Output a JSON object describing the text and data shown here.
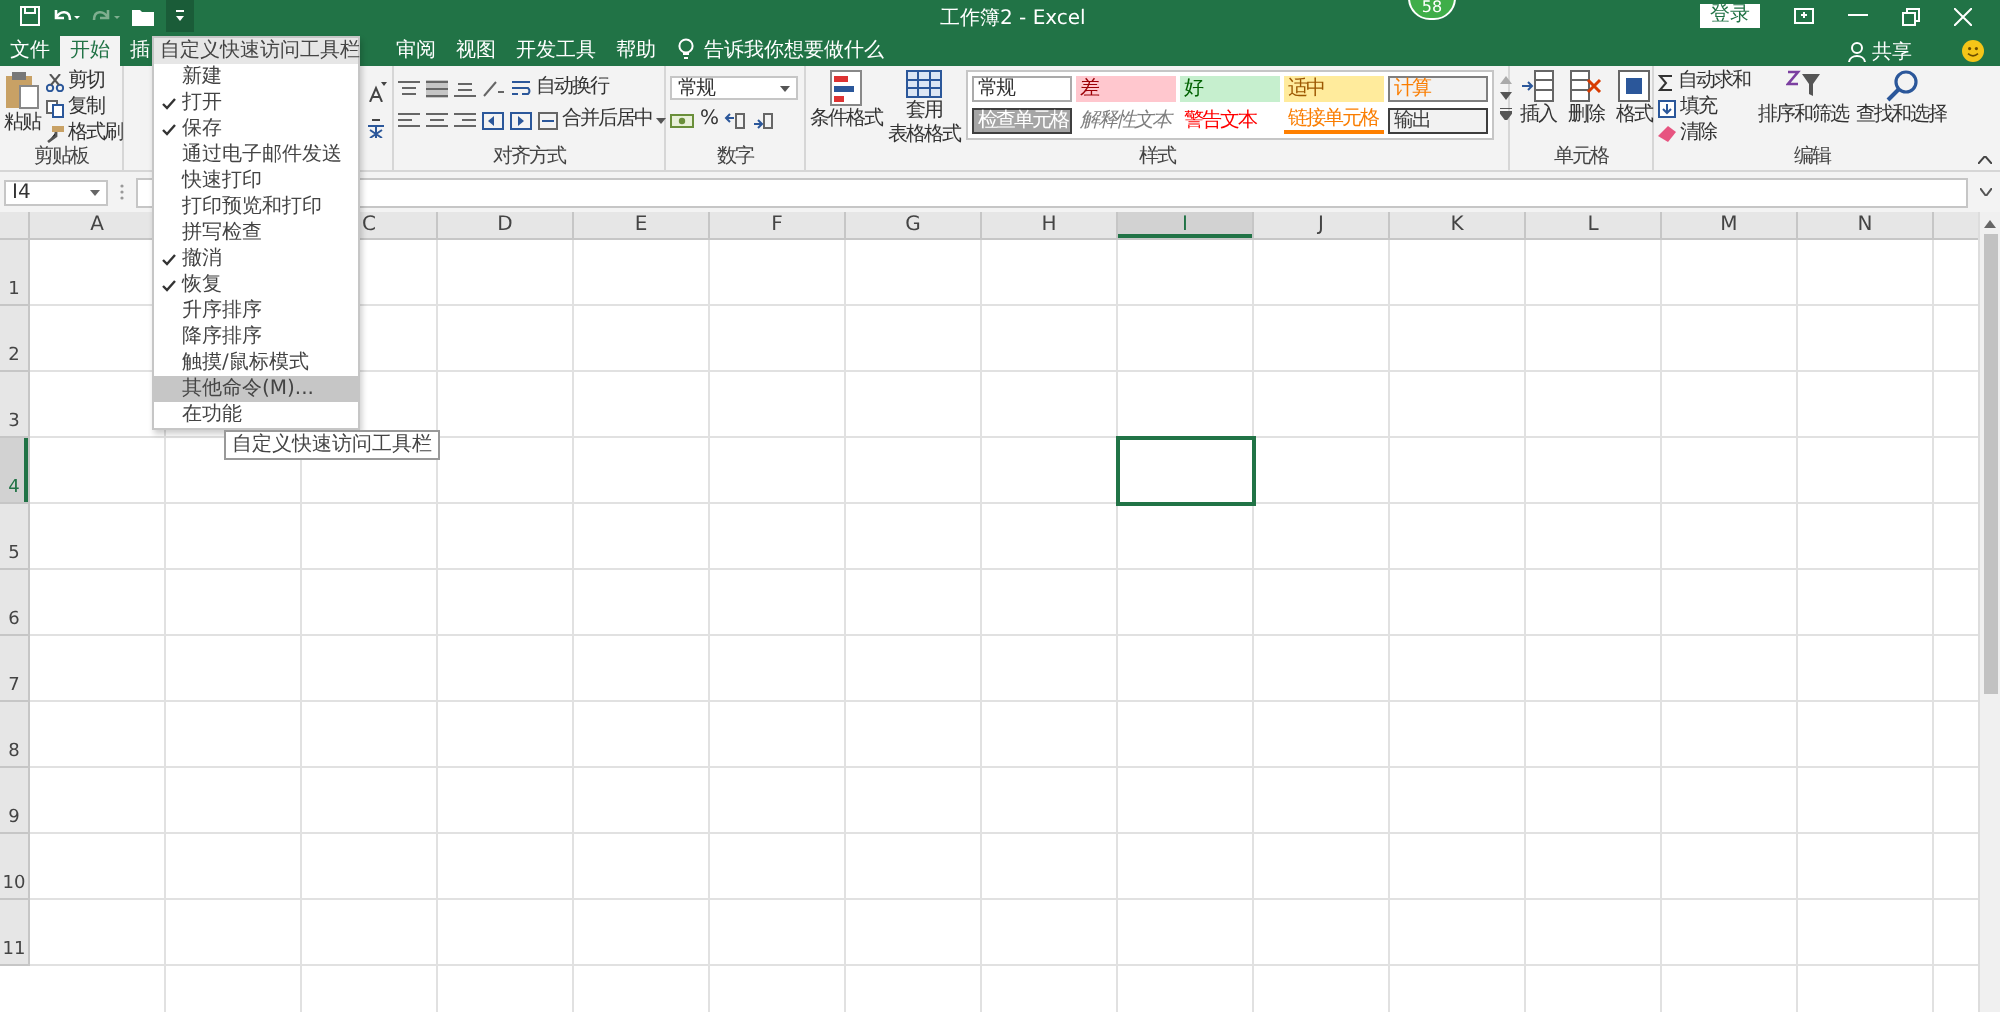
{
  "window": {
    "title": "工作簿2 - Excel",
    "sign_in": "登录",
    "badge": "58"
  },
  "tabs": [
    {
      "label": "文件",
      "selected": false
    },
    {
      "label": "开始",
      "selected": true
    },
    {
      "label": "插",
      "selected": false
    },
    {
      "label": "审阅",
      "selected": false
    },
    {
      "label": "视图",
      "selected": false
    },
    {
      "label": "开发工具",
      "selected": false
    },
    {
      "label": "帮助",
      "selected": false
    }
  ],
  "tell_me": "告诉我你想要做什么",
  "share": "共享",
  "ribbon": {
    "clipboard": {
      "paste": "粘贴",
      "cut": "剪切",
      "copy": "复制",
      "format_painter": "格式刷",
      "label": "剪贴板"
    },
    "alignment": {
      "wrap_text": "自动换行",
      "merge_center": "合并后居中",
      "label": "对齐方式"
    },
    "number": {
      "format": "常规",
      "percent": "%",
      "label": "数字"
    },
    "styles": {
      "conditional_formatting": "条件格式",
      "format_as_table": [
        "套用",
        "表格格式"
      ],
      "label": "样式",
      "gallery": [
        {
          "label": "常规",
          "kind": "normal"
        },
        {
          "label": "差",
          "kind": "bad"
        },
        {
          "label": "好",
          "kind": "good"
        },
        {
          "label": "适中",
          "kind": "neutral"
        },
        {
          "label": "计算",
          "kind": "calculation"
        },
        {
          "label": "检查单元格",
          "kind": "check"
        },
        {
          "label": "解释性文本",
          "kind": "explanatory"
        },
        {
          "label": "警告文本",
          "kind": "warning"
        },
        {
          "label": "链接单元格",
          "kind": "linked"
        },
        {
          "label": "输出",
          "kind": "output"
        }
      ]
    },
    "cells": {
      "insert": "插入",
      "delete": "删除",
      "format": "格式",
      "label": "单元格"
    },
    "editing": {
      "autosum": "自动求和",
      "fill": "填充",
      "clear": "清除",
      "sort_filter": "排序和筛选",
      "find_select": "查找和选择",
      "label": "编辑"
    }
  },
  "name_box": "I4",
  "columns": [
    {
      "label": "A",
      "selected": false
    },
    {
      "label": "C",
      "selected": false
    },
    {
      "label": "D",
      "selected": false
    },
    {
      "label": "E",
      "selected": false
    },
    {
      "label": "F",
      "selected": false
    },
    {
      "label": "G",
      "selected": false
    },
    {
      "label": "H",
      "selected": false
    },
    {
      "label": "I",
      "selected": true
    },
    {
      "label": "J",
      "selected": false
    },
    {
      "label": "K",
      "selected": false
    },
    {
      "label": "L",
      "selected": false
    },
    {
      "label": "M",
      "selected": false
    },
    {
      "label": "N",
      "selected": false
    }
  ],
  "rows": [
    {
      "label": "1",
      "selected": false
    },
    {
      "label": "2",
      "selected": false
    },
    {
      "label": "3",
      "selected": false
    },
    {
      "label": "4",
      "selected": true
    },
    {
      "label": "5",
      "selected": false
    },
    {
      "label": "6",
      "selected": false
    },
    {
      "label": "7",
      "selected": false
    },
    {
      "label": "8",
      "selected": false
    },
    {
      "label": "9",
      "selected": false
    },
    {
      "label": "10",
      "selected": false
    },
    {
      "label": "11",
      "selected": false
    }
  ],
  "qat_menu": {
    "title": "自定义快速访问工具栏",
    "items": [
      {
        "label": "新建",
        "checked": false,
        "selected": false
      },
      {
        "label": "打开",
        "checked": true,
        "selected": false
      },
      {
        "label": "保存",
        "checked": true,
        "selected": false
      },
      {
        "label": "通过电子邮件发送",
        "checked": false,
        "selected": false
      },
      {
        "label": "快速打印",
        "checked": false,
        "selected": false
      },
      {
        "label": "打印预览和打印",
        "checked": false,
        "selected": false
      },
      {
        "label": "拼写检查",
        "checked": false,
        "selected": false
      },
      {
        "label": "撤消",
        "checked": true,
        "selected": false
      },
      {
        "label": "恢复",
        "checked": true,
        "selected": false
      },
      {
        "label": "升序排序",
        "checked": false,
        "selected": false
      },
      {
        "label": "降序排序",
        "checked": false,
        "selected": false
      },
      {
        "label": "触摸/鼠标模式",
        "checked": false,
        "selected": false
      },
      {
        "label": "其他命令(M)...",
        "checked": false,
        "selected": true
      },
      {
        "label": "在功能",
        "checked": false,
        "selected": false
      }
    ]
  },
  "tooltip": "自定义快速访问工具栏"
}
